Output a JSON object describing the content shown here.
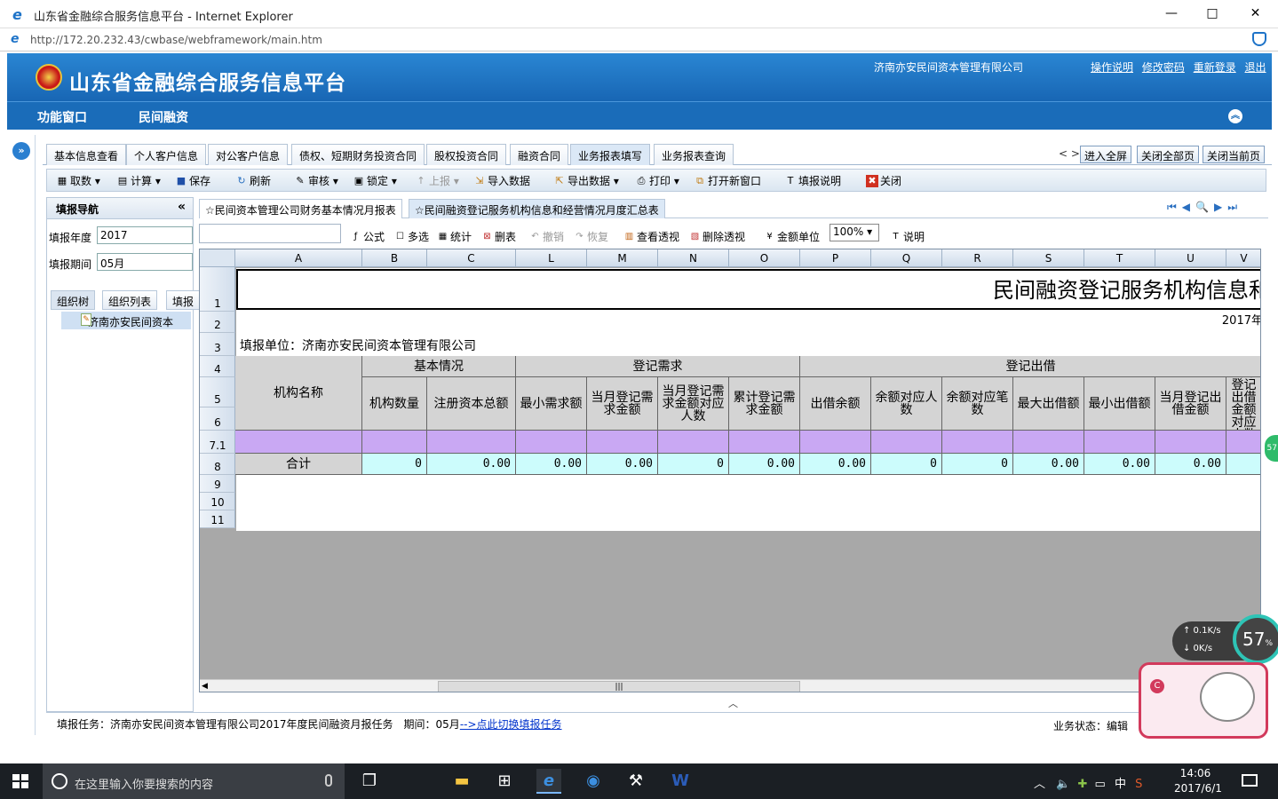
{
  "window": {
    "title": "山东省金融综合服务信息平台 - Internet Explorer",
    "url": "http://172.20.232.43/cwbase/webframework/main.htm",
    "min_glyph": "—",
    "max_glyph": "□",
    "close_glyph": "✕"
  },
  "app": {
    "title": "山东省金融综合服务信息平台",
    "company": "济南亦安民间资本管理有限公司",
    "links": [
      "操作说明",
      "修改密码",
      "重新登录",
      "退出"
    ],
    "nav": [
      "功能窗口",
      "民间融资"
    ]
  },
  "tabs": [
    "基本信息查看",
    "个人客户信息",
    "对公客户信息",
    "债权、短期财务投资合同",
    "股权投资合同",
    "融资合同",
    "业务报表填写",
    "业务报表查询"
  ],
  "tab_controls": {
    "arrows": "< >",
    "buttons": [
      "进入全屏",
      "关闭全部页",
      "关闭当前页"
    ]
  },
  "toolbar": [
    {
      "icon": "fetch-icon",
      "glyph": "▦",
      "label": "取数 ▾",
      "enabled": true
    },
    {
      "icon": "calculator-icon",
      "glyph": "▤",
      "label": "计算 ▾",
      "enabled": true
    },
    {
      "icon": "save-icon",
      "glyph": "■",
      "label": "保存",
      "enabled": true
    },
    {
      "icon": "refresh-icon",
      "glyph": "↻",
      "label": "刷新",
      "enabled": true
    },
    {
      "icon": "audit-icon",
      "glyph": "✎",
      "label": "审核 ▾",
      "enabled": true
    },
    {
      "icon": "lock-icon",
      "glyph": "▣",
      "label": "锁定 ▾",
      "enabled": true
    },
    {
      "icon": "upload-icon",
      "glyph": "↑",
      "label": "上报 ▾",
      "enabled": false
    },
    {
      "icon": "import-icon",
      "glyph": "⇲",
      "label": "导入数据",
      "enabled": true
    },
    {
      "icon": "export-icon",
      "glyph": "⇱",
      "label": "导出数据 ▾",
      "enabled": true
    },
    {
      "icon": "print-icon",
      "glyph": "⎙",
      "label": "打印 ▾",
      "enabled": true
    },
    {
      "icon": "new-window-icon",
      "glyph": "⧉",
      "label": "打开新窗口",
      "enabled": true
    },
    {
      "icon": "text-icon",
      "glyph": "T",
      "label": "填报说明",
      "enabled": true
    },
    {
      "icon": "close-red-icon",
      "glyph": "✖",
      "label": "关闭",
      "enabled": true
    }
  ],
  "nav_panel": {
    "title": "填报导航",
    "collapse_glyph": "«",
    "year_label": "填报年度",
    "year_value": "2017",
    "period_label": "填报期间",
    "period_value": "05月",
    "subtabs": [
      "组织树",
      "组织列表",
      "填报"
    ],
    "tree_item": "济南亦安民间资本"
  },
  "report_tabs": [
    "☆民间资本管理公司财务基本情况月报表",
    "☆民间融资登记服务机构信息和经营情况月度汇总表"
  ],
  "report_toolbar": {
    "items": [
      {
        "icon": "formula-icon",
        "glyph": "ƒ",
        "label": "公式",
        "enabled": true
      },
      {
        "icon": "checkbox-icon",
        "glyph": "☐",
        "label": "多选",
        "enabled": true
      },
      {
        "icon": "stats-icon",
        "glyph": "▦",
        "label": "统计",
        "enabled": true
      },
      {
        "icon": "delete-table-icon",
        "glyph": "⊠",
        "label": "删表",
        "enabled": true
      },
      {
        "icon": "undo-icon",
        "glyph": "↶",
        "label": "撤销",
        "enabled": false
      },
      {
        "icon": "redo-icon",
        "glyph": "↷",
        "label": "恢复",
        "enabled": false
      },
      {
        "icon": "view-pivot-icon",
        "glyph": "▥",
        "label": "查看透视",
        "enabled": true
      },
      {
        "icon": "delete-pivot-icon",
        "glyph": "▧",
        "label": "删除透视",
        "enabled": true
      },
      {
        "icon": "unit-icon",
        "glyph": "¥",
        "label": "金额单位",
        "enabled": true
      }
    ],
    "zoom": "100%",
    "help": {
      "icon": "text-icon",
      "glyph": "T",
      "label": "说明"
    }
  },
  "sheet": {
    "columns": [
      "A",
      "B",
      "C",
      "L",
      "M",
      "N",
      "O",
      "P",
      "Q",
      "R",
      "S",
      "T",
      "U",
      "V"
    ],
    "row_numbers": [
      "1",
      "2",
      "3",
      "4",
      "5",
      "6",
      "7.1",
      "8",
      "9",
      "10",
      "11"
    ],
    "title": "民间融资登记服务机构信息和经营情况月度汇总表",
    "date_fragment": "2017年",
    "unit_line": "填报单位：济南亦安民间资本管理有限公司",
    "group_headers": [
      "基本情况",
      "登记需求",
      "登记出借"
    ],
    "org_name_header": "机构名称",
    "col_headers": [
      "机构数量",
      "注册资本总额",
      "最小需求额",
      "当月登记需求金额",
      "当月登记需求金额对应人数",
      "累计登记需求金额",
      "出借余额",
      "余额对应人数",
      "余额对应笔数",
      "最大出借额",
      "最小出借额",
      "当月登记出借金额",
      "当月登记出借金额对应人数"
    ],
    "total_label": "合计",
    "total_values": [
      "0",
      "0.00",
      "0.00",
      "0.00",
      "0",
      "0.00",
      "0.00",
      "0",
      "0",
      "0.00",
      "0.00",
      "0.00",
      ""
    ]
  },
  "status": {
    "task_prefix": "填报任务：济南亦安民间资本管理有限公司2017年度民间融资月报任务　期间：05月",
    "task_link": "-->点此切换填报任务",
    "state": "业务状态：编辑"
  },
  "widget": {
    "up": "↑ 0.1K/s",
    "down": "↓ 0K/s",
    "percent": "57"
  },
  "taskbar": {
    "search_placeholder": "在这里输入你要搜索的内容",
    "time": "14:06",
    "date": "2017/6/1",
    "ime": "中"
  }
}
